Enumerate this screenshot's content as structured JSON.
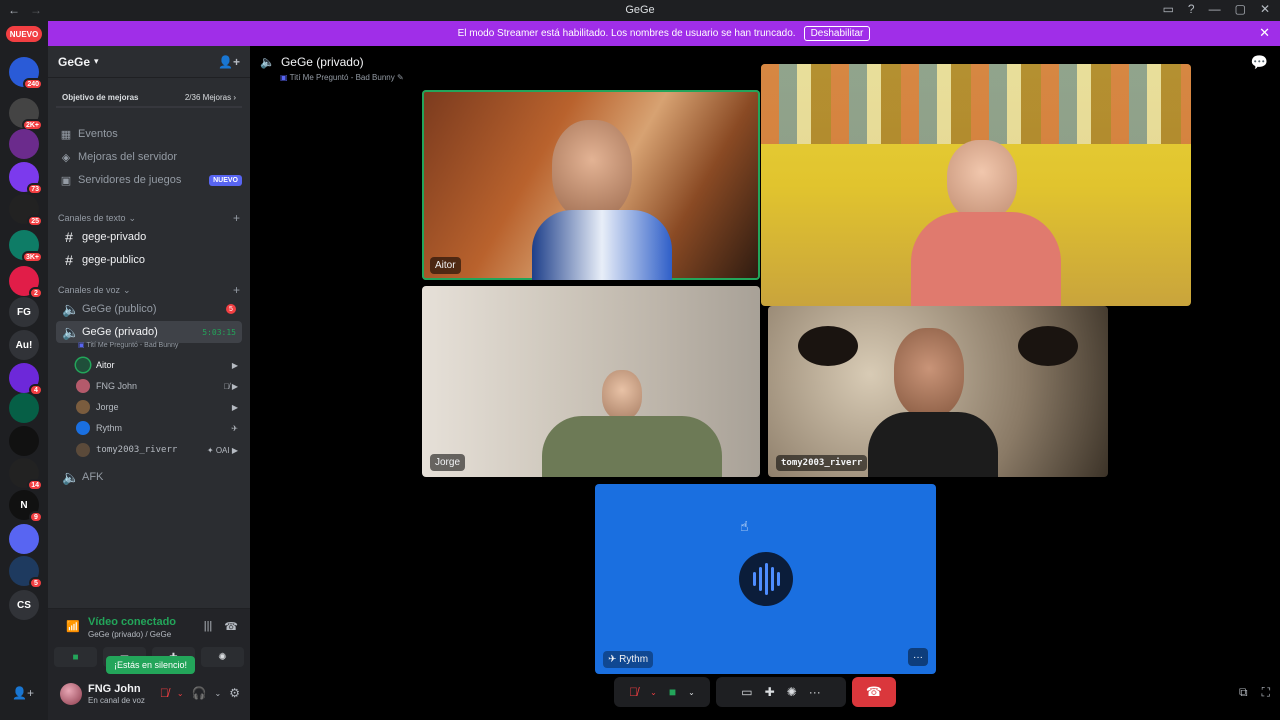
{
  "window": {
    "title": "GeGe",
    "back": "←",
    "forward": "→"
  },
  "banner": {
    "message": "El modo Streamer está habilitado. Los nombres de usuario se han truncado.",
    "button": "Deshabilitar",
    "close": "✕"
  },
  "guilds": {
    "new_pill": "NUEVO",
    "items": [
      {
        "label": "",
        "badge": "240",
        "color": "#2a5bd7"
      },
      {
        "label": "",
        "badge": "2K+",
        "color": "#444"
      },
      {
        "label": "",
        "badge": "",
        "color": "#6b2b8c"
      },
      {
        "label": "",
        "badge": "73",
        "color": "#7c3aed"
      },
      {
        "label": "",
        "badge": "25",
        "color": "#222"
      },
      {
        "label": "",
        "badge": "3K+",
        "color": "#0e7c66"
      },
      {
        "label": "",
        "badge": "2",
        "color": "#e11d48"
      },
      {
        "label": "FG",
        "badge": "",
        "color": "#313338"
      },
      {
        "label": "Au!",
        "badge": "",
        "color": "#313338"
      },
      {
        "label": "",
        "badge": "4",
        "color": "#6d28d9"
      },
      {
        "label": "",
        "badge": "",
        "color": "#065f46"
      },
      {
        "label": "",
        "badge": "",
        "color": "#111"
      },
      {
        "label": "",
        "badge": "14",
        "color": "#222"
      },
      {
        "label": "N",
        "badge": "9",
        "color": "#111"
      },
      {
        "label": "",
        "badge": "",
        "color": "#5865f2"
      },
      {
        "label": "",
        "badge": "5",
        "color": "#1e3a5f"
      },
      {
        "label": "CS",
        "badge": "",
        "color": "#313338"
      }
    ]
  },
  "server": {
    "name": "GeGe",
    "boost_goal": "Objetivo de mejoras",
    "boost_progress": "2/36 Mejoras",
    "menu": [
      {
        "label": "Eventos",
        "icon": "calendar-icon",
        "glyph": "▦"
      },
      {
        "label": "Mejoras del servidor",
        "icon": "boost-icon",
        "glyph": "◈"
      },
      {
        "label": "Servidores de juegos",
        "icon": "game-icon",
        "glyph": "▣",
        "pill": "NUEVO"
      }
    ],
    "text_category": "Canales de texto",
    "text_channels": [
      "gege-privado",
      "gege-publico"
    ],
    "voice_category": "Canales de voz",
    "voice_channels": {
      "public": {
        "name": "GeGe (publico)",
        "badge": "5"
      },
      "private": {
        "name": "GeGe (privado)",
        "timer": "5:03:15",
        "activity": "Tití Me Preguntó - Bad Bunny"
      },
      "afk": {
        "name": "AFK"
      }
    },
    "members": [
      {
        "name": "Aitor",
        "icons": "▶",
        "color": "#1f4f3a"
      },
      {
        "name": "FNG John",
        "icons": "🎙̸ ▶",
        "color": "#b45a6b"
      },
      {
        "name": "Jorge",
        "icons": "▶",
        "color": "#7a5c3e"
      },
      {
        "name": "Rythm",
        "icons": "✈",
        "color": "#1a6fe0"
      },
      {
        "name": "tomy2003_riverr",
        "icons": "✦ OAI ▶",
        "color": "#5b4a3a"
      }
    ]
  },
  "voice_panel": {
    "title": "Vídeo conectado",
    "subtitle": "GeGe (privado) / GeGe",
    "tooltip": "¡Estás en silencio!"
  },
  "user": {
    "name": "FNG John",
    "status": "En canal de voz"
  },
  "call": {
    "title": "GeGe (privado)",
    "activity": "Tití Me Preguntó - Bad Bunny",
    "tiles": {
      "aitor": "Aitor",
      "jorge": "Jorge",
      "tomy": "tomy2003_riverr",
      "rythm": "Rythm"
    }
  }
}
